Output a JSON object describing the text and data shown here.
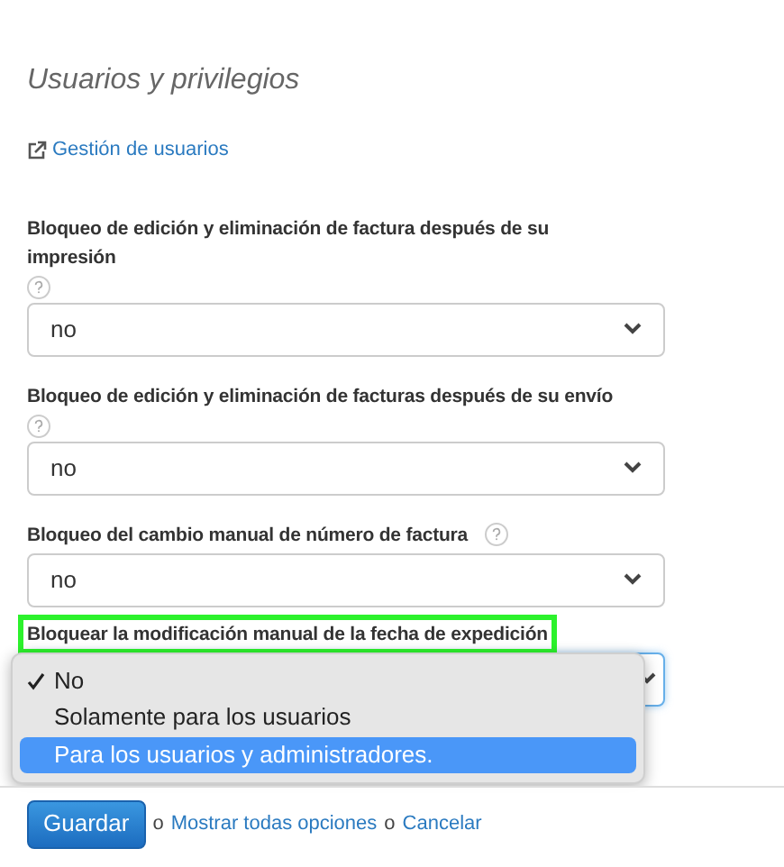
{
  "title": "Usuarios y privilegios",
  "link": "Gestión de usuarios",
  "settings": [
    {
      "label": "Bloqueo de edición y eliminación de factura después de su impresión",
      "kind": "help-below",
      "highlighted": false,
      "focused": false,
      "value": "no"
    },
    {
      "label": "Bloqueo de edición y eliminación de facturas después de su envío",
      "kind": "help-below",
      "highlighted": false,
      "focused": false,
      "value": "no"
    },
    {
      "label": "Bloqueo del cambio manual de número de factura",
      "kind": "help-inline",
      "highlighted": false,
      "focused": false,
      "value": "no"
    },
    {
      "label": "Bloquear la modificación manual de la fecha de expedición",
      "kind": "plain",
      "highlighted": true,
      "focused": true
    }
  ],
  "menu": {
    "options": [
      {
        "label": "No",
        "checked": true,
        "selected": false
      },
      {
        "label": "Solamente para los usuarios",
        "checked": false,
        "selected": false
      },
      {
        "label": "Para los usuarios y administradores.",
        "checked": false,
        "selected": true
      }
    ]
  },
  "footer": {
    "save": "Guardar",
    "sep1": "o",
    "show_all": "Mostrar todas opciones",
    "sep2": "o",
    "cancel": "Cancelar"
  }
}
